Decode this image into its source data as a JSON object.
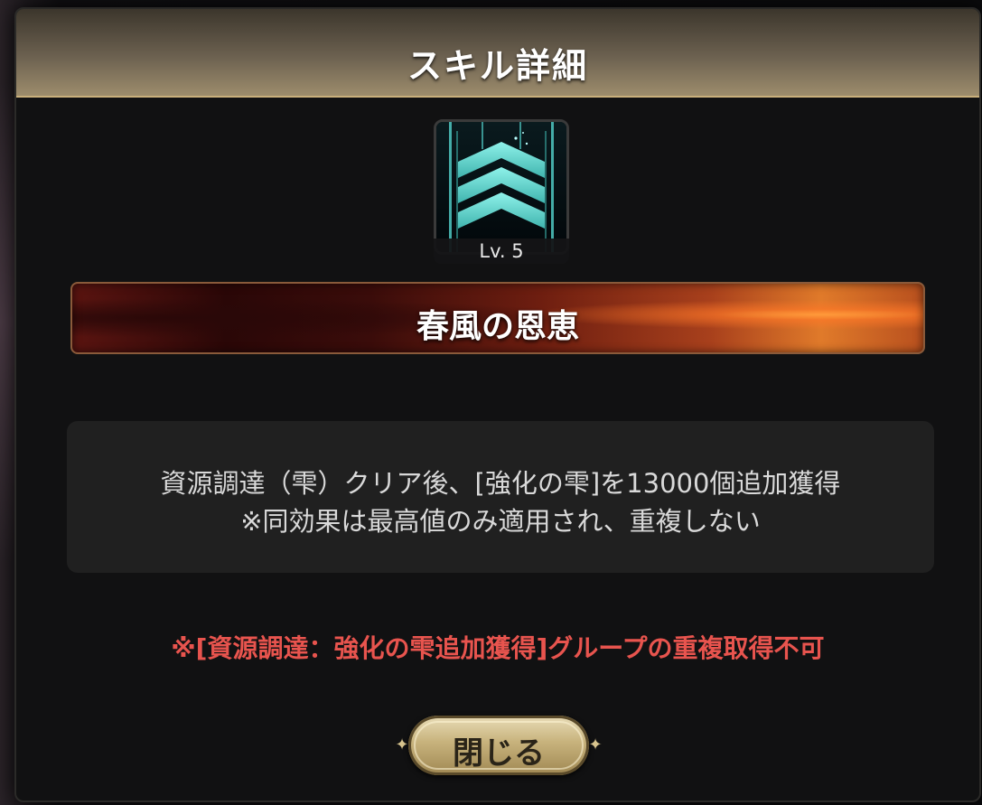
{
  "dialog": {
    "title": "スキル詳細"
  },
  "skill": {
    "icon": "triple-chevron-up-icon",
    "level_label": "Lv. 5",
    "name": "春風の恩恵",
    "description_line1": "資源調達（雫）クリア後、[強化の雫]を13000個追加獲得",
    "description_line2": "※同効果は最高値のみ適用され、重複しない"
  },
  "warning_text": "※[資源調達：強化の雫追加獲得]グループの重複取得不可",
  "close_button": {
    "label": "閉じる"
  },
  "colors": {
    "accent_gold": "#c9b07c",
    "warning_red": "#e8544e",
    "icon_teal": "#5fd6d0"
  }
}
